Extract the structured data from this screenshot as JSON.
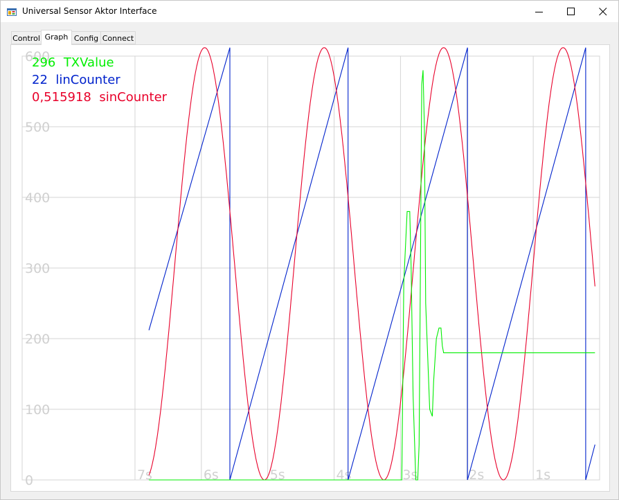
{
  "window": {
    "title": "Universal Sensor Aktor Interface",
    "icon": "app-icon",
    "controls": [
      "minimize-icon",
      "maximize-icon",
      "close-icon"
    ]
  },
  "tabs": [
    {
      "label": "Control",
      "active": false
    },
    {
      "label": "Graph",
      "active": true
    },
    {
      "label": "Config",
      "active": false
    },
    {
      "label": "Connect",
      "active": false
    }
  ],
  "legend": [
    {
      "value": "296",
      "name": "TXValue",
      "color": "#00ee00"
    },
    {
      "value": "22",
      "name": "linCounter",
      "color": "#0022cc"
    },
    {
      "value": "0,515918",
      "name": "sinCounter",
      "color": "#e8002a"
    }
  ],
  "chart_data": {
    "type": "line",
    "ylim": [
      0,
      600
    ],
    "y_ticks": [
      "0",
      "100",
      "200",
      "300",
      "400",
      "500",
      "600"
    ],
    "x_ticks": [
      "7s",
      "6s",
      "5s",
      "4s",
      "3s",
      "2s",
      "1s"
    ],
    "grid": true,
    "colors": {
      "grid": "#d4d4d4",
      "tick_label": "#d0d0d0"
    },
    "series": [
      {
        "name": "linCounter",
        "color": "#0022cc",
        "points": [
          [
            -6.79,
            212
          ],
          [
            -5.57,
            612
          ],
          [
            -5.57,
            0
          ],
          [
            -3.79,
            612
          ],
          [
            -3.79,
            0
          ],
          [
            -1.99,
            612
          ],
          [
            -1.99,
            0
          ],
          [
            -0.21,
            612
          ],
          [
            -0.21,
            0
          ],
          [
            -0.07,
            50
          ]
        ]
      },
      {
        "name": "sinCounter",
        "color": "#e8002a",
        "sine": {
          "x_start": -6.79,
          "x_end": -0.07,
          "period": 1.8,
          "peak_x": -4.15,
          "center": 306,
          "amplitude": 306
        }
      },
      {
        "name": "TXValue",
        "color": "#00ee00",
        "points": [
          [
            -6.79,
            0
          ],
          [
            -3.05,
            0
          ],
          [
            -2.98,
            0
          ],
          [
            -2.95,
            280
          ],
          [
            -2.9,
            380
          ],
          [
            -2.86,
            380
          ],
          [
            -2.84,
            300
          ],
          [
            -2.81,
            120
          ],
          [
            -2.77,
            0
          ],
          [
            -2.74,
            0
          ],
          [
            -2.72,
            50
          ],
          [
            -2.7,
            300
          ],
          [
            -2.68,
            560
          ],
          [
            -2.66,
            580
          ],
          [
            -2.64,
            500
          ],
          [
            -2.62,
            250
          ],
          [
            -2.56,
            100
          ],
          [
            -2.52,
            90
          ],
          [
            -2.5,
            140
          ],
          [
            -2.46,
            200
          ],
          [
            -2.42,
            215
          ],
          [
            -2.39,
            215
          ],
          [
            -2.37,
            190
          ],
          [
            -2.35,
            180
          ],
          [
            -0.07,
            180
          ]
        ]
      }
    ]
  }
}
